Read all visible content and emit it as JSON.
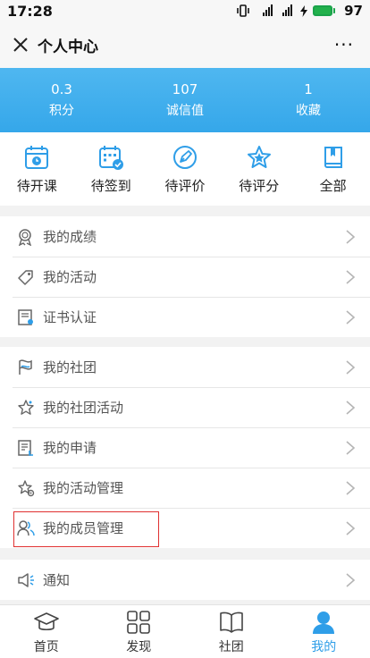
{
  "status_bar": {
    "time": "17:28",
    "signal_text": "4G 4G",
    "battery_level": "97"
  },
  "header": {
    "title": "个人中心",
    "more_label": "···"
  },
  "stats": [
    {
      "value": "0.3",
      "label": "积分"
    },
    {
      "value": "107",
      "label": "诚信值"
    },
    {
      "value": "1",
      "label": "收藏"
    }
  ],
  "quick_actions": [
    {
      "label": "待开课",
      "icon": "calendar-clock-icon"
    },
    {
      "label": "待签到",
      "icon": "calendar-check-icon"
    },
    {
      "label": "待评价",
      "icon": "pen-circle-icon"
    },
    {
      "label": "待评分",
      "icon": "star-icon"
    },
    {
      "label": "全部",
      "icon": "book-icon"
    }
  ],
  "menu_groups": [
    [
      {
        "label": "我的成绩",
        "icon": "medal-icon"
      },
      {
        "label": "我的活动",
        "icon": "tag-icon"
      },
      {
        "label": "证书认证",
        "icon": "certificate-icon"
      }
    ],
    [
      {
        "label": "我的社团",
        "icon": "flag-icon"
      },
      {
        "label": "我的社团活动",
        "icon": "star-outline-icon"
      },
      {
        "label": "我的申请",
        "icon": "application-icon"
      },
      {
        "label": "我的活动管理",
        "icon": "star-gear-icon"
      },
      {
        "label": "我的成员管理",
        "icon": "members-icon"
      }
    ],
    [
      {
        "label": "通知",
        "icon": "speaker-icon"
      }
    ]
  ],
  "tabbar": [
    {
      "label": "首页",
      "icon": "graduation-cap-icon",
      "active": false
    },
    {
      "label": "发现",
      "icon": "grid-icon",
      "active": false
    },
    {
      "label": "社团",
      "icon": "open-book-icon",
      "active": false
    },
    {
      "label": "我的",
      "icon": "user-icon",
      "active": true
    }
  ],
  "colors": {
    "accent": "#2f9ee8",
    "banner": "#3aaaeb",
    "highlight": "#e03030"
  }
}
